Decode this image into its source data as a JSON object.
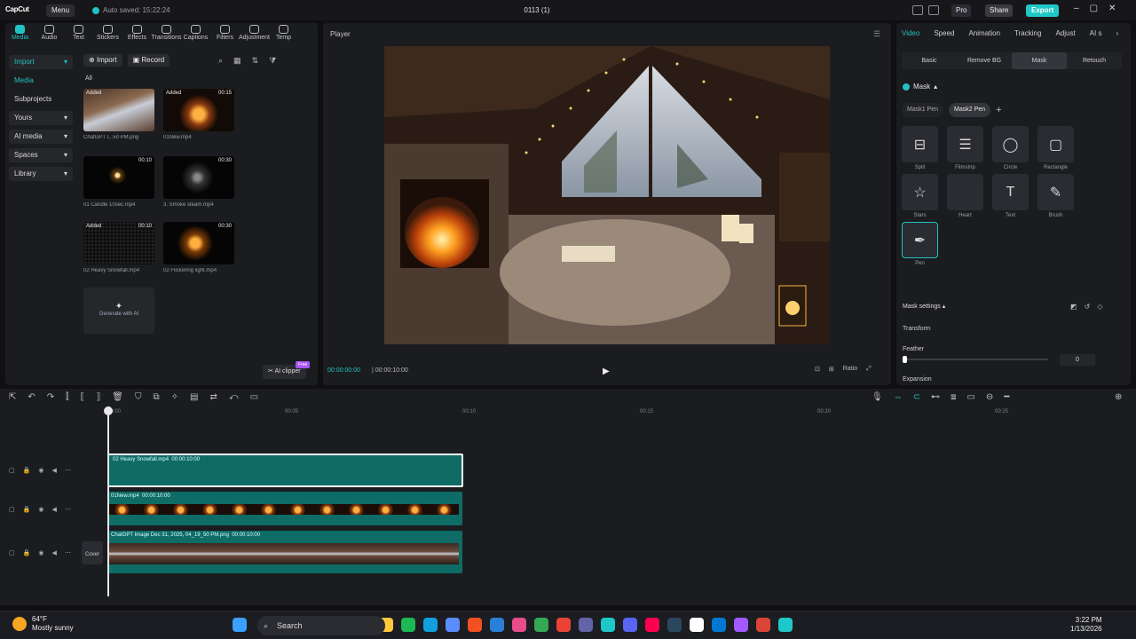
{
  "titlebar": {
    "logo": "CapCut",
    "menu": "Menu",
    "autosave": "Auto saved: 15:22:24",
    "project": "0113 (1)",
    "pro": "Pro",
    "share": "Share",
    "export": "Export"
  },
  "tools": [
    {
      "label": "Media",
      "icon": "media-icon"
    },
    {
      "label": "Audio",
      "icon": "audio-icon"
    },
    {
      "label": "Text",
      "icon": "text-icon"
    },
    {
      "label": "Stickers",
      "icon": "sticker-icon"
    },
    {
      "label": "Effects",
      "icon": "effects-icon"
    },
    {
      "label": "Transitions",
      "icon": "transitions-icon"
    },
    {
      "label": "Captions",
      "icon": "captions-icon"
    },
    {
      "label": "Filters",
      "icon": "filters-icon"
    },
    {
      "label": "Adjustment",
      "icon": "adjust-icon"
    },
    {
      "label": "Temp",
      "icon": "template-icon"
    }
  ],
  "side_nav": [
    "Import",
    "Media",
    "Subprojects",
    "Yours",
    "AI media",
    "Spaces",
    "Library"
  ],
  "media_head": {
    "import": "Import",
    "record": "Record",
    "all": "All"
  },
  "media": [
    {
      "name": "ChatGPT I...50 PM.png",
      "tag": "Added",
      "dur": ""
    },
    {
      "name": "01New.mp4",
      "tag": "Added",
      "dur": "00:15"
    },
    {
      "name": "01 Candle 10sec.mp4",
      "tag": "",
      "dur": "00:10"
    },
    {
      "name": "3. Smoke steam.mp4",
      "tag": "",
      "dur": "00:30"
    },
    {
      "name": "02 Heavy Snowfall.mp4",
      "tag": "Added",
      "dur": "00:10"
    },
    {
      "name": "02 Flickering light.mp4",
      "tag": "",
      "dur": "00:30"
    }
  ],
  "generate": "Generate with AI",
  "ai_clipper": "AI clipper",
  "free": "Free",
  "player": {
    "title": "Player",
    "current": "00:00:00:00",
    "total": "00:00:10:00",
    "ratio": "Ratio"
  },
  "right": {
    "tabs": [
      "Video",
      "Speed",
      "Animation",
      "Tracking",
      "Adjust",
      "AI s"
    ],
    "subtabs": [
      "Basic",
      "Remove BG",
      "Mask",
      "Retouch"
    ],
    "mask": "Mask",
    "mask_tabs": [
      "Mask1 Pen",
      "Mask2 Pen"
    ],
    "shapes": [
      {
        "label": "Split",
        "icon": "split-icon"
      },
      {
        "label": "Filmstrip",
        "icon": "filmstrip-icon"
      },
      {
        "label": "Circle",
        "icon": "circle-icon"
      },
      {
        "label": "Rectangle",
        "icon": "rectangle-icon"
      },
      {
        "label": "Stars",
        "icon": "star-icon"
      },
      {
        "label": "Heart",
        "icon": "heart-icon"
      },
      {
        "label": "Text",
        "icon": "text-icon"
      },
      {
        "label": "Brush",
        "icon": "brush-icon"
      },
      {
        "label": "Pen",
        "icon": "pen-icon"
      }
    ],
    "mask_settings": "Mask settings",
    "transform": "Transform",
    "feather": "Feather",
    "feather_value": "0",
    "expansion": "Expansion"
  },
  "timeline": {
    "ruler": [
      "00:00",
      "00:05",
      "00:10",
      "00:15",
      "00:20",
      "00:25"
    ],
    "clips": [
      {
        "label": "02 Heavy Snowfall.mp4",
        "dur": "00:00:10:00"
      },
      {
        "label": "01New.mp4",
        "dur": "00:00:10:00"
      },
      {
        "label": "ChatGPT Image Dec 31, 2025, 04_19_50 PM.png",
        "dur": "00:00:10:00"
      }
    ],
    "cover": "Cover"
  },
  "taskbar": {
    "temp": "64°F",
    "weather": "Mostly sunny",
    "search": "Search",
    "time": "3:22 PM",
    "date": "1/13/2026"
  }
}
